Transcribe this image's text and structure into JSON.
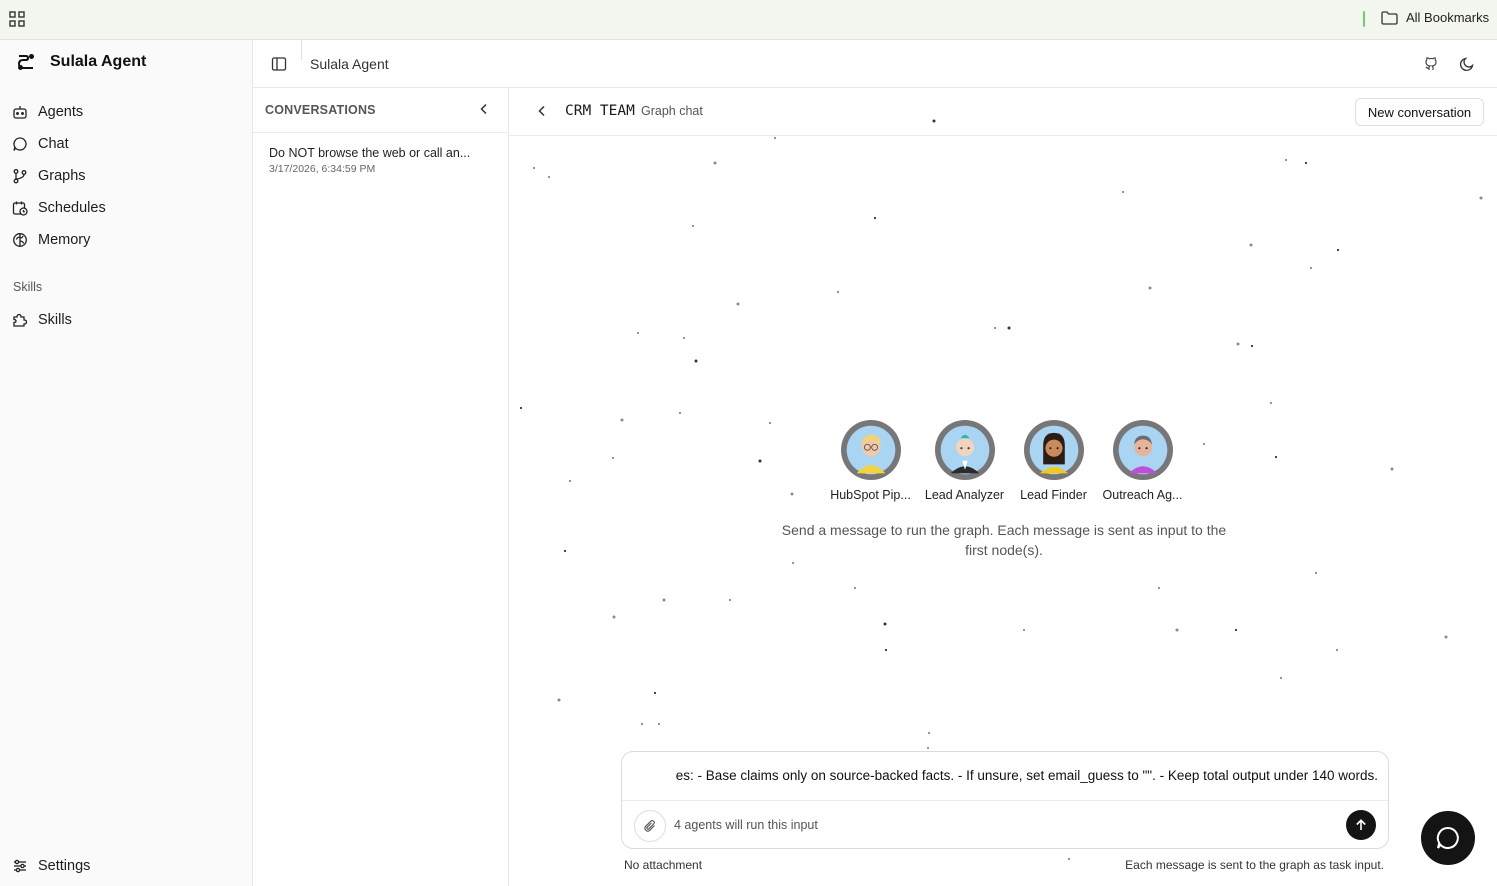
{
  "bookmarks_bar": {
    "apps_icon": "apps-grid-icon",
    "all_bookmarks_label": "All Bookmarks",
    "folder_icon": "folder-icon"
  },
  "sidebar": {
    "brand": {
      "name": "Sulala Agent",
      "logo_icon": "sulala-logo-icon"
    },
    "nav": [
      {
        "label": "Agents",
        "icon": "robot-icon"
      },
      {
        "label": "Chat",
        "icon": "chat-bubble-icon"
      },
      {
        "label": "Graphs",
        "icon": "git-branch-icon"
      },
      {
        "label": "Schedules",
        "icon": "calendar-clock-icon"
      },
      {
        "label": "Memory",
        "icon": "brain-icon"
      }
    ],
    "skills_section_label": "Skills",
    "skills_item": {
      "label": "Skills",
      "icon": "puzzle-icon"
    },
    "settings": {
      "label": "Settings",
      "icon": "sliders-icon"
    }
  },
  "topbar": {
    "title": "Sulala Agent",
    "toggle_icon": "sidebar-toggle-icon",
    "github_icon": "github-icon",
    "theme_icon": "moon-icon"
  },
  "conversations": {
    "header": "CONVERSATIONS",
    "items": [
      {
        "title": "Do NOT browse the web or call an...",
        "date": "3/17/2026, 6:34:59 PM"
      }
    ]
  },
  "chat": {
    "graph_name": "CRM TEAM",
    "graph_subtitle": "Graph chat",
    "new_conversation_label": "New conversation",
    "agents": [
      {
        "name": "HubSpot Pip..."
      },
      {
        "name": "Lead Analyzer"
      },
      {
        "name": "Lead Finder"
      },
      {
        "name": "Outreach Ag..."
      }
    ],
    "hint": "Send a message to run the graph. Each message is sent as input to the first node(s).",
    "composer": {
      "value": "es: - Base claims only on source-backed facts. - If unsure, set email_guess to \"\". - Keep total output under 140 words.",
      "run_hint": "4 agents will run this input",
      "attach_icon": "paperclip-icon",
      "send_icon": "arrow-up-icon"
    },
    "no_attachment": "No attachment",
    "task_hint": "Each message is sent to the graph as task input.",
    "fab_icon": "chat-bubble-icon"
  }
}
